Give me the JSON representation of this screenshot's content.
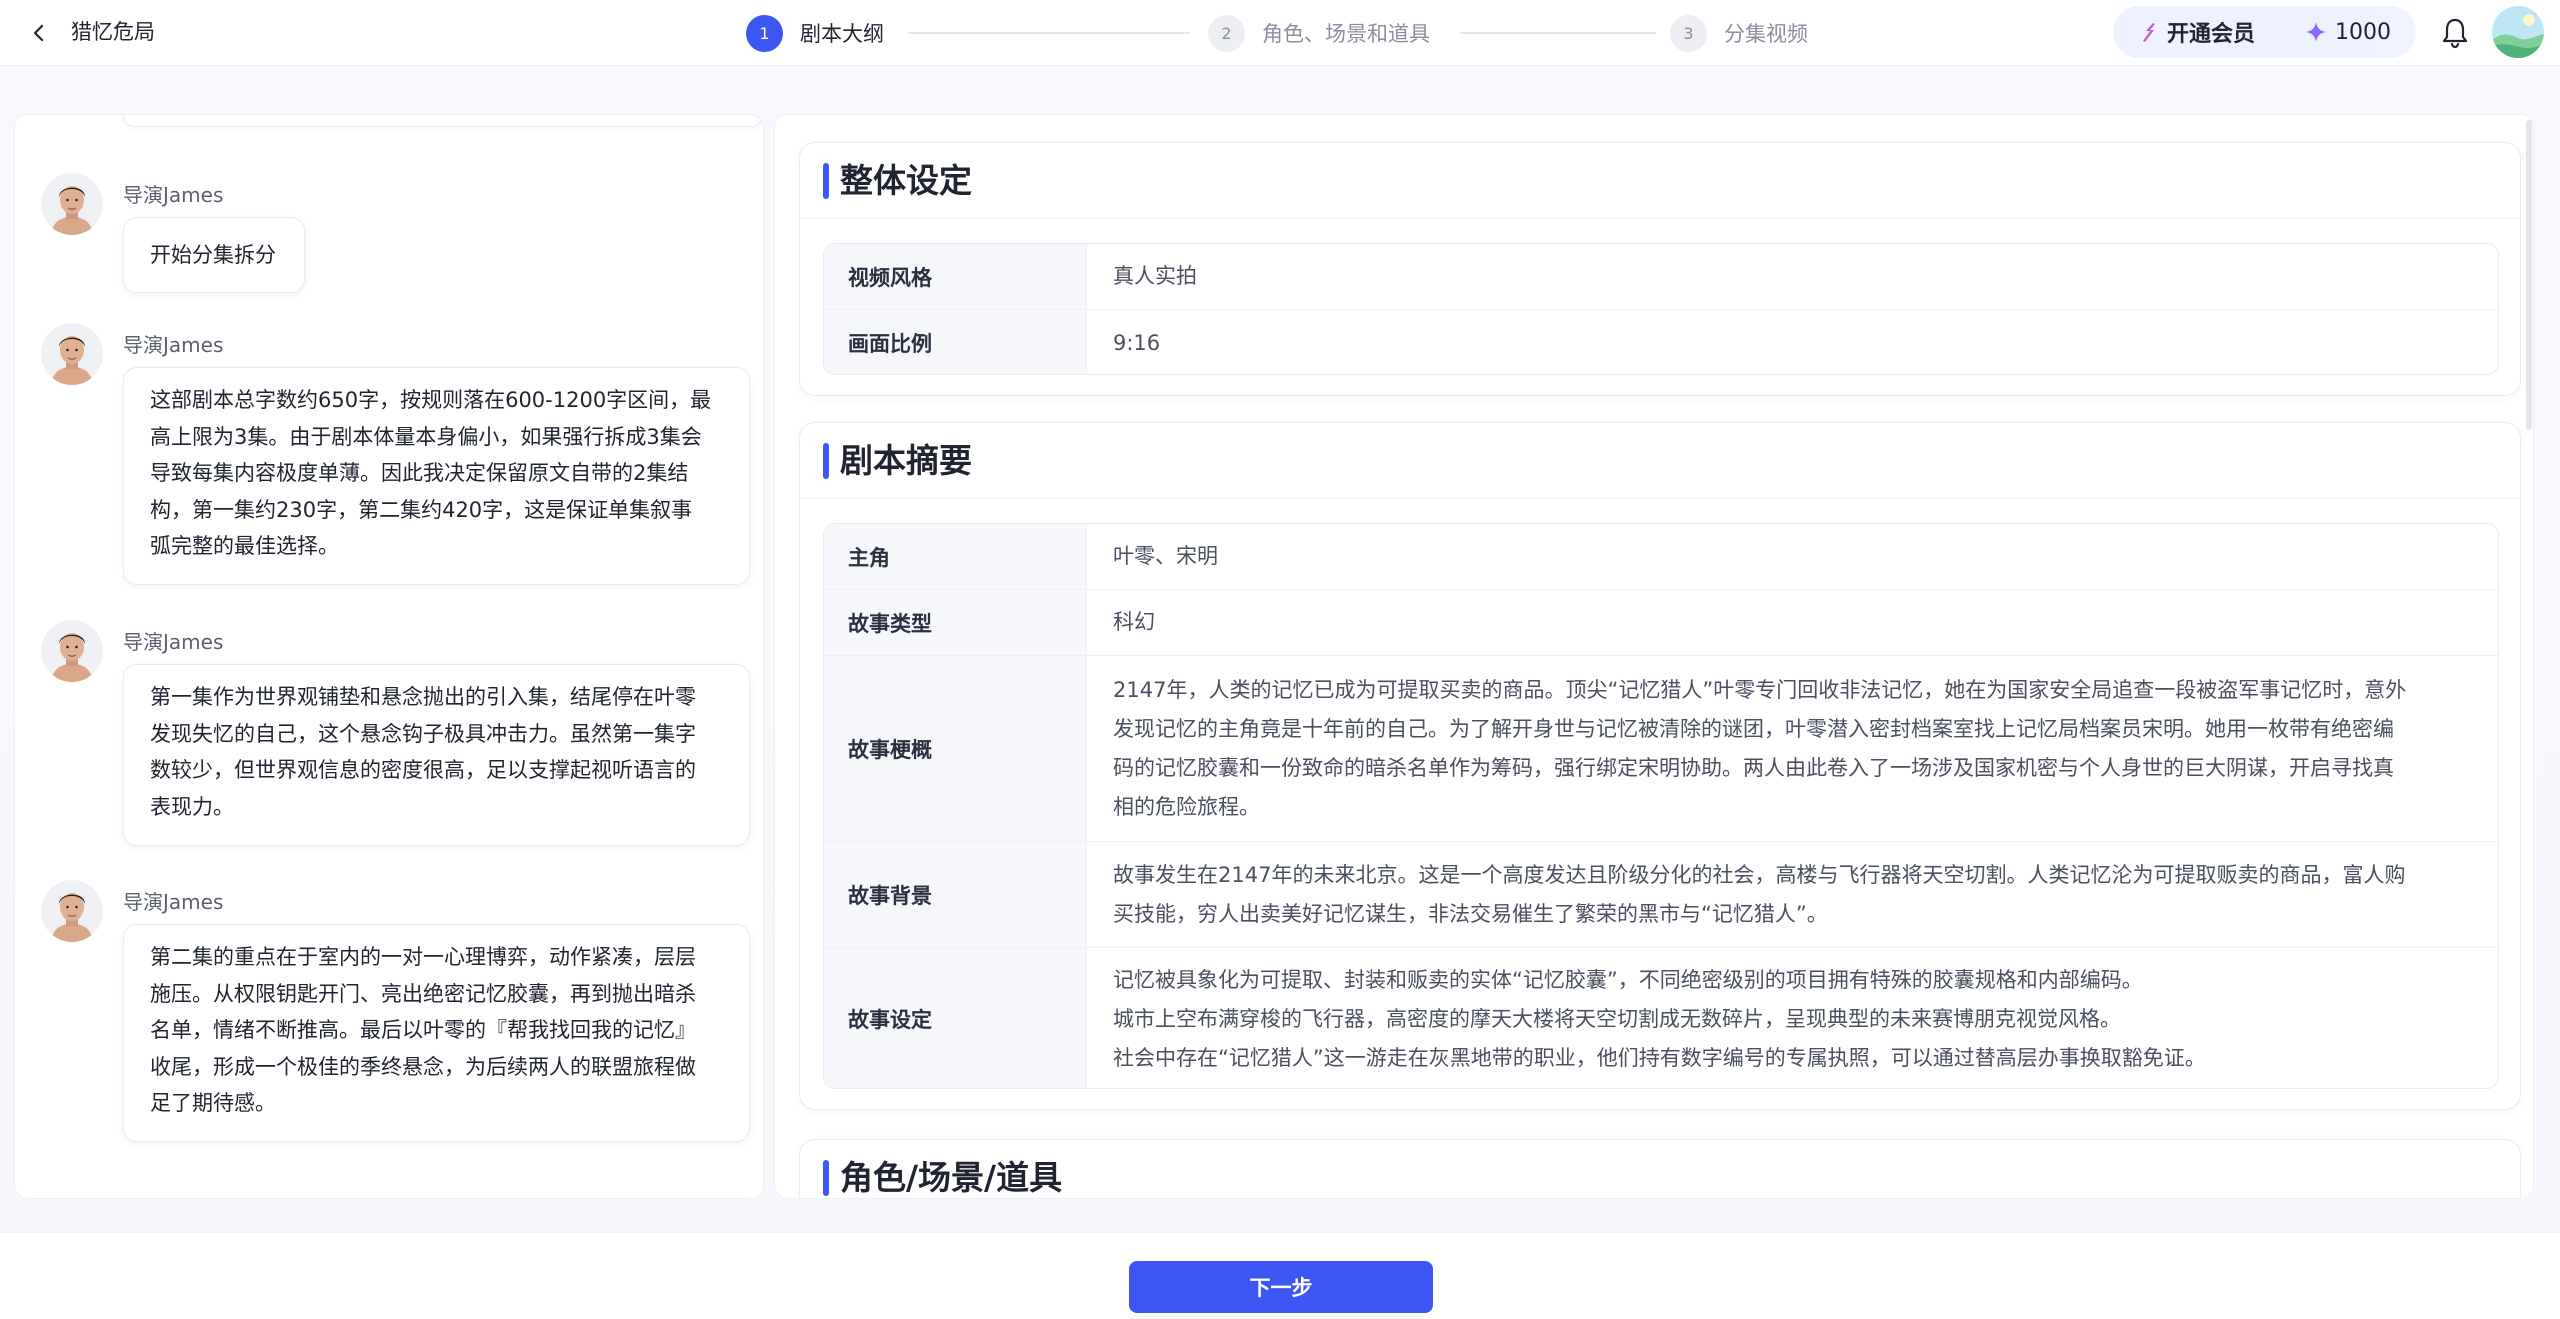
{
  "header": {
    "project_title": "猎忆危局",
    "steps": [
      {
        "num": "1",
        "label": "剧本大纲"
      },
      {
        "num": "2",
        "label": "角色、场景和道具"
      },
      {
        "num": "3",
        "label": "分集视频"
      }
    ],
    "vip_label": "开通会员",
    "credits": "1000"
  },
  "chat": {
    "messages": [
      {
        "name": "导演James",
        "text": "开始分集拆分"
      },
      {
        "name": "导演James",
        "lines": [
          "这部剧本总字数约650字，按规则落在600-1200字区间，最",
          "高上限为3集。由于剧本体量本身偏小，如果强行拆成3集会",
          "导致每集内容极度单薄。因此我决定保留原文自带的2集结",
          "构，第一集约230字，第二集约420字，这是保证单集叙事",
          "弧完整的最佳选择。"
        ]
      },
      {
        "name": "导演James",
        "lines": [
          "第一集作为世界观铺垫和悬念抛出的引入集，结尾停在叶零",
          "发现失忆的自己，这个悬念钩子极具冲击力。虽然第一集字",
          "数较少，但世界观信息的密度很高，足以支撑起视听语言的",
          "表现力。"
        ]
      },
      {
        "name": "导演James",
        "lines": [
          "第二集的重点在于室内的一对一心理博弈，动作紧凑，层层",
          "施压。从权限钥匙开门、亮出绝密记忆胶囊，再到抛出暗杀",
          "名单，情绪不断推高。最后以叶零的『帮我找回我的记忆』",
          "收尾，形成一个极佳的季终悬念，为后续两人的联盟旅程做",
          "足了期待感。"
        ]
      }
    ]
  },
  "overall": {
    "title": "整体设定",
    "rows": [
      {
        "key": "视频风格",
        "value": "真人实拍"
      },
      {
        "key": "画面比例",
        "value": "9:16"
      }
    ]
  },
  "summary": {
    "title": "剧本摘要",
    "rows": [
      {
        "key": "主角",
        "lines": [
          "叶零、宋明"
        ]
      },
      {
        "key": "故事类型",
        "lines": [
          "科幻"
        ]
      },
      {
        "key": "故事梗概",
        "lines": [
          "2147年，人类的记忆已成为可提取买卖的商品。顶尖“记忆猎人”叶零专门回收非法记忆，她在为国家安全局追查一段被盗军事记忆时，意外",
          "发现记忆的主角竟是十年前的自己。为了解开身世与记忆被清除的谜团，叶零潜入密封档案室找上记忆局档案员宋明。她用一枚带有绝密编",
          "码的记忆胶囊和一份致命的暗杀名单作为筹码，强行绑定宋明协助。两人由此卷入了一场涉及国家机密与个人身世的巨大阴谋，开启寻找真",
          "相的危险旅程。"
        ]
      },
      {
        "key": "故事背景",
        "lines": [
          "故事发生在2147年的未来北京。这是一个高度发达且阶级分化的社会，高楼与飞行器将天空切割。人类记忆沦为可提取贩卖的商品，富人购",
          "买技能，穷人出卖美好记忆谋生，非法交易催生了繁荣的黑市与“记忆猎人”。"
        ]
      },
      {
        "key": "故事设定",
        "lines": [
          "记忆被具象化为可提取、封装和贩卖的实体“记忆胶囊”，不同绝密级别的项目拥有特殊的胶囊规格和内部编码。",
          "城市上空布满穿梭的飞行器，高密度的摩天大楼将天空切割成无数碎片，呈现典型的未来赛博朋克视觉风格。",
          "社会中存在“记忆猎人”这一游走在灰黑地带的职业，他们持有数字编号的专属执照，可以通过替高层办事换取豁免证。"
        ]
      }
    ]
  },
  "assets": {
    "title": "角色/场景/道具"
  },
  "footer": {
    "next_label": "下一步"
  },
  "icons": {
    "back": "chevron-left-icon",
    "vip": "vip-bolt-icon",
    "credit": "diamond-icon",
    "bell": "bell-icon",
    "accent": "#3d57f4"
  }
}
